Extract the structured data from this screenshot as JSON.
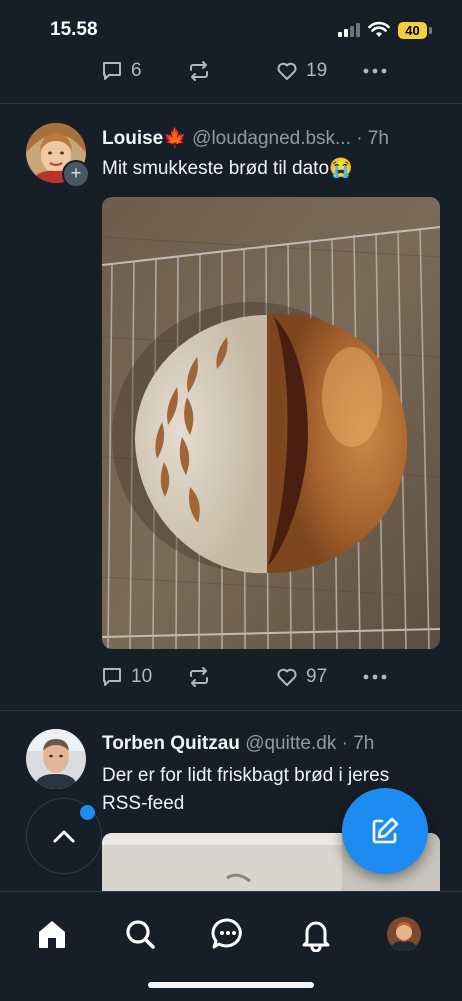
{
  "status_bar": {
    "time": "15.58",
    "battery": "40"
  },
  "top_post_actions": {
    "replies": "6",
    "likes": "19"
  },
  "posts": [
    {
      "name": "Louise🍁",
      "handle": "@loudagned.bsk...",
      "dot": "·",
      "time": "7h",
      "text": "Mit smukkeste brød til dato😭",
      "replies": "10",
      "likes": "97"
    },
    {
      "name": "Torben Quitzau",
      "handle": "@quitte.dk",
      "dot": "·",
      "time": "7h",
      "text": "Der er for lidt friskbagt brød i jeres RSS-feed"
    }
  ],
  "icons": {
    "reply": "reply-icon",
    "repost": "repost-icon",
    "like": "heart-icon",
    "more": "more-icon",
    "home": "home-icon",
    "search": "search-icon",
    "chat": "chat-icon",
    "notifications": "bell-icon",
    "profile": "avatar",
    "compose": "compose-icon",
    "scroll_top": "chevron-up-icon"
  },
  "colors": {
    "background": "#161e27",
    "accent": "#1d8cf0",
    "muted": "#aeb7c2"
  }
}
